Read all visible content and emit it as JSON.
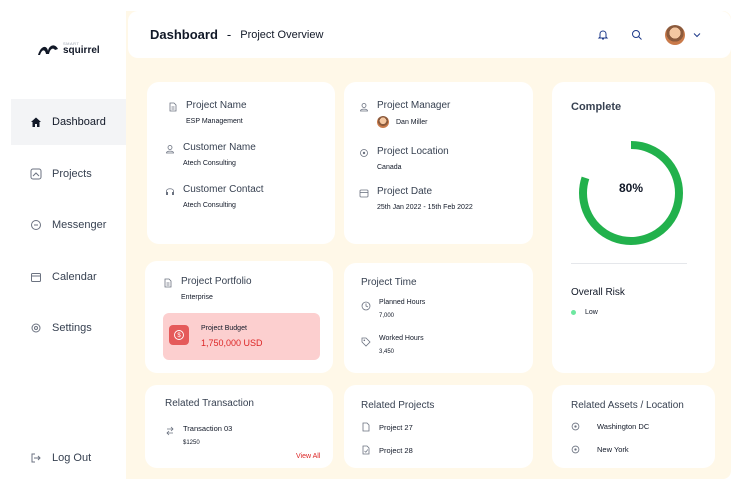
{
  "brand": {
    "small": "SMART",
    "name": "squirrel"
  },
  "sidebar": {
    "items": [
      {
        "label": "Dashboard",
        "icon": "home-icon"
      },
      {
        "label": "Projects",
        "icon": "projects-icon"
      },
      {
        "label": "Messenger",
        "icon": "chat-icon"
      },
      {
        "label": "Calendar",
        "icon": "calendar-icon"
      },
      {
        "label": "Settings",
        "icon": "gear-icon"
      }
    ],
    "logout": "Log Out"
  },
  "header": {
    "title": "Dashboard",
    "separator": "-",
    "subtitle": "Project Overview"
  },
  "project": {
    "name_label": "Project Name",
    "name": "ESP Management",
    "customer_label": "Customer Name",
    "customer": "Atech Consulting",
    "contact_label": "Customer Contact",
    "contact": "Atech Consulting",
    "manager_label": "Project Manager",
    "manager": "Dan Miller",
    "location_label": "Project Location",
    "location": "Canada",
    "date_label": "Project Date",
    "date": "25th Jan 2022 - 15th Feb 2022"
  },
  "complete": {
    "title": "Complete",
    "percent_label": "80%",
    "percent": 0.8,
    "risk_title": "Overall Risk",
    "risk": "Low",
    "color": "#22b14c",
    "risk_color": "#6ee7a0"
  },
  "portfolio": {
    "label": "Project Portfolio",
    "value": "Enterprise",
    "budget_label": "Project Budget",
    "budget": "1,750,000 USD"
  },
  "time": {
    "title": "Project Time",
    "planned_label": "Planned Hours",
    "planned": "7,000",
    "worked_label": "Worked Hours",
    "worked": "3,450"
  },
  "transactions": {
    "title": "Related Transaction",
    "name": "Transaction 03",
    "amount": "$1250",
    "view_all": "View All"
  },
  "related_projects": {
    "title": "Related Projects",
    "items": [
      "Project 27",
      "Project 28"
    ]
  },
  "assets": {
    "title": "Related Assets / Location",
    "items": [
      "Washington DC",
      "New York"
    ]
  }
}
